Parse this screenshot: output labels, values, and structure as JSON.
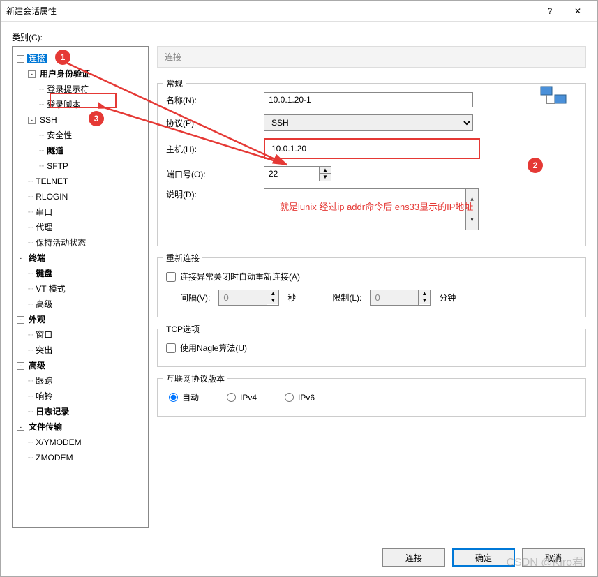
{
  "window": {
    "title": "新建会话属性",
    "help": "?",
    "close": "✕"
  },
  "category_label": "类别(C):",
  "tree": {
    "connection": "连接",
    "user_auth": "用户身份验证",
    "login_prompt": "登录提示符",
    "login_script": "登录脚本",
    "ssh": "SSH",
    "security": "安全性",
    "tunnel": "隧道",
    "sftp": "SFTP",
    "telnet": "TELNET",
    "rlogin": "RLOGIN",
    "serial": "串口",
    "proxy": "代理",
    "keepalive": "保持活动状态",
    "terminal": "终端",
    "keyboard": "键盘",
    "vtmode": "VT 模式",
    "advanced_term": "高级",
    "appearance": "外观",
    "window_item": "窗口",
    "highlight": "突出",
    "advanced": "高级",
    "trace": "跟踪",
    "bell": "响铃",
    "logging": "日志记录",
    "filetransfer": "文件传输",
    "xymodem": "X/YMODEM",
    "zmodem": "ZMODEM"
  },
  "header": "连接",
  "general": {
    "title": "常规",
    "name_label": "名称(N):",
    "name_value": "10.0.1.20-1",
    "protocol_label": "协议(P):",
    "protocol_value": "SSH",
    "host_label": "主机(H):",
    "host_value": "10.0.1.20",
    "port_label": "端口号(O):",
    "port_value": "22",
    "desc_label": "说明(D):"
  },
  "annotation_text": "就是lunix 经过ip addr命令后 ens33显示的IP地址",
  "reconnect": {
    "title": "重新连接",
    "checkbox": "连接异常关闭时自动重新连接(A)",
    "interval_label": "间隔(V):",
    "interval_value": "0",
    "seconds": "秒",
    "limit_label": "限制(L):",
    "limit_value": "0",
    "minutes": "分钟"
  },
  "tcp": {
    "title": "TCP选项",
    "nagle": "使用Nagle算法(U)"
  },
  "ipver": {
    "title": "互联网协议版本",
    "auto": "自动",
    "ipv4": "IPv4",
    "ipv6": "IPv6"
  },
  "buttons": {
    "connect": "连接",
    "ok": "确定",
    "cancel": "取消"
  },
  "badges": {
    "b1": "1",
    "b2": "2",
    "b3": "3"
  },
  "watermark": "CSDN @Kiro君"
}
